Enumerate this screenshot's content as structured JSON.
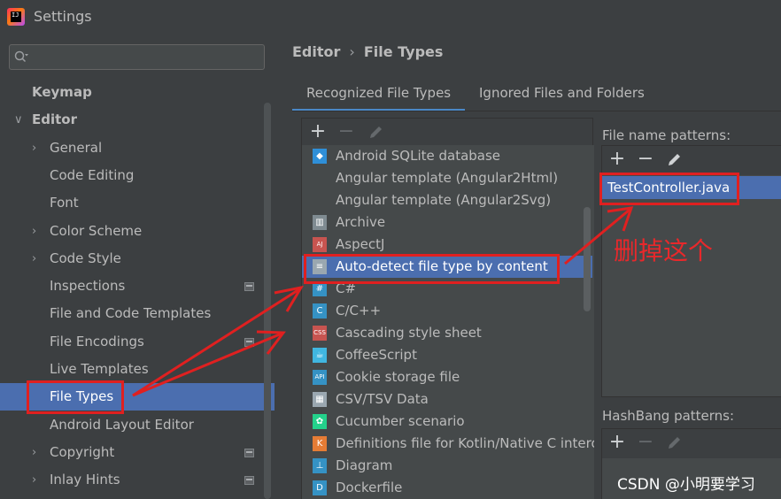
{
  "window": {
    "title": "Settings"
  },
  "search": {
    "placeholder": ""
  },
  "sidebar": {
    "items": [
      {
        "label": "Keymap",
        "level": 0,
        "expander": "",
        "bold": true,
        "project_icon": false,
        "selected": false
      },
      {
        "label": "Editor",
        "level": 0,
        "expander": "expanded",
        "bold": true,
        "project_icon": false,
        "selected": false
      },
      {
        "label": "General",
        "level": 1,
        "expander": "collapsed",
        "bold": false,
        "project_icon": false,
        "selected": false
      },
      {
        "label": "Code Editing",
        "level": 1,
        "expander": "",
        "bold": false,
        "project_icon": false,
        "selected": false
      },
      {
        "label": "Font",
        "level": 1,
        "expander": "",
        "bold": false,
        "project_icon": false,
        "selected": false
      },
      {
        "label": "Color Scheme",
        "level": 1,
        "expander": "collapsed",
        "bold": false,
        "project_icon": false,
        "selected": false
      },
      {
        "label": "Code Style",
        "level": 1,
        "expander": "collapsed",
        "bold": false,
        "project_icon": false,
        "selected": false
      },
      {
        "label": "Inspections",
        "level": 1,
        "expander": "",
        "bold": false,
        "project_icon": true,
        "selected": false
      },
      {
        "label": "File and Code Templates",
        "level": 1,
        "expander": "",
        "bold": false,
        "project_icon": false,
        "selected": false
      },
      {
        "label": "File Encodings",
        "level": 1,
        "expander": "",
        "bold": false,
        "project_icon": true,
        "selected": false
      },
      {
        "label": "Live Templates",
        "level": 1,
        "expander": "",
        "bold": false,
        "project_icon": false,
        "selected": false
      },
      {
        "label": "File Types",
        "level": 1,
        "expander": "",
        "bold": false,
        "project_icon": false,
        "selected": true
      },
      {
        "label": "Android Layout Editor",
        "level": 1,
        "expander": "",
        "bold": false,
        "project_icon": false,
        "selected": false
      },
      {
        "label": "Copyright",
        "level": 1,
        "expander": "collapsed",
        "bold": false,
        "project_icon": true,
        "selected": false
      },
      {
        "label": "Inlay Hints",
        "level": 1,
        "expander": "collapsed",
        "bold": false,
        "project_icon": true,
        "selected": false
      }
    ]
  },
  "breadcrumb": {
    "parent": "Editor",
    "separator": "›",
    "current": "File Types"
  },
  "tabs": [
    {
      "label": "Recognized File Types",
      "active": true
    },
    {
      "label": "Ignored Files and Folders",
      "active": false
    }
  ],
  "toolbar": {
    "add_label": "+",
    "remove_label": "−",
    "edit_icon": "pencil-icon"
  },
  "file_types": [
    {
      "label": "Android SQLite database",
      "icon": "sqlite-icon",
      "color": "#2f8fd8",
      "glyph": "◆",
      "selected": false
    },
    {
      "label": "Angular template (Angular2Html)",
      "icon": "",
      "color": "",
      "glyph": "",
      "selected": false
    },
    {
      "label": "Angular template (Angular2Svg)",
      "icon": "",
      "color": "",
      "glyph": "",
      "selected": false
    },
    {
      "label": "Archive",
      "icon": "archive-icon",
      "color": "#7f8b91",
      "glyph": "▥",
      "selected": false
    },
    {
      "label": "AspectJ",
      "icon": "aspectj-icon",
      "color": "#c75450",
      "glyph": "AJ",
      "selected": false
    },
    {
      "label": "Auto-detect file type by content",
      "icon": "text-file-icon",
      "color": "#9aa7b0",
      "glyph": "≡",
      "selected": true
    },
    {
      "label": "C#",
      "icon": "csharp-icon",
      "color": "#3592c4",
      "glyph": "#",
      "selected": false
    },
    {
      "label": "C/C++",
      "icon": "cpp-icon",
      "color": "#3592c4",
      "glyph": "C",
      "selected": false
    },
    {
      "label": "Cascading style sheet",
      "icon": "css-icon",
      "color": "#c75450",
      "glyph": "CSS",
      "selected": false
    },
    {
      "label": "CoffeeScript",
      "icon": "coffeescript-icon",
      "color": "#40b6e0",
      "glyph": "☕",
      "selected": false
    },
    {
      "label": "Cookie storage file",
      "icon": "api-icon",
      "color": "#3592c4",
      "glyph": "API",
      "selected": false
    },
    {
      "label": "CSV/TSV Data",
      "icon": "csv-icon",
      "color": "#9aa7b0",
      "glyph": "▦",
      "selected": false
    },
    {
      "label": "Cucumber scenario",
      "icon": "cucumber-icon",
      "color": "#23d18b",
      "glyph": "✿",
      "selected": false
    },
    {
      "label": "Definitions file for Kotlin/Native C interop",
      "icon": "kotlin-icon",
      "color": "#e57c35",
      "glyph": "K",
      "selected": false
    },
    {
      "label": "Diagram",
      "icon": "diagram-icon",
      "color": "#3592c4",
      "glyph": "⊥",
      "selected": false
    },
    {
      "label": "Dockerfile",
      "icon": "dockerfile-icon",
      "color": "#3592c4",
      "glyph": "D",
      "selected": false
    }
  ],
  "patterns": {
    "label": "File name patterns:",
    "items": [
      "TestController.java"
    ]
  },
  "hashbang": {
    "label": "HashBang patterns:"
  },
  "annotation": {
    "text": "删掉这个",
    "color": "#e8282b"
  },
  "watermark": {
    "text": "CSDN @小明要学习"
  },
  "colors": {
    "selection": "#4b6eaf",
    "background": "#3c3f41",
    "list_background": "#45494a",
    "annotation_red": "#e02020",
    "tab_underline": "#4a88c7"
  }
}
